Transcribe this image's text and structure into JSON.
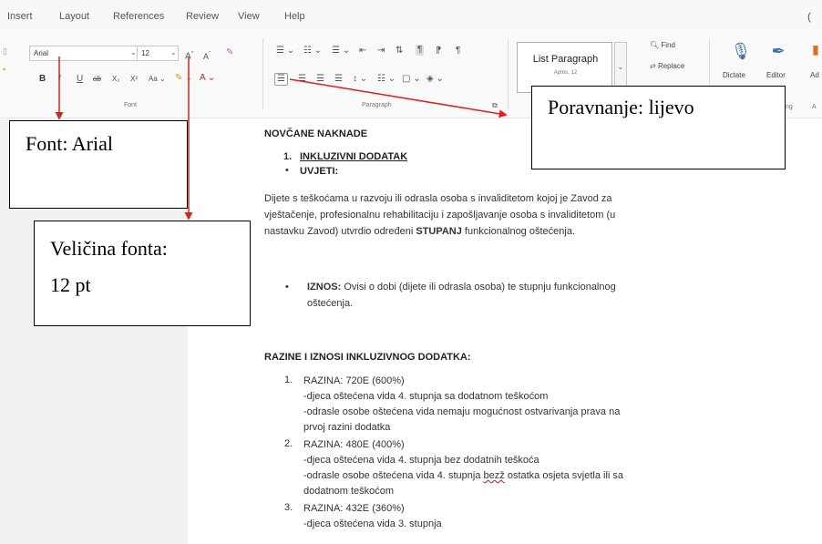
{
  "menu": [
    "Insert",
    "Layout",
    "References",
    "Review",
    "View",
    "Help"
  ],
  "ribbon": {
    "font_name": "Arial",
    "font_size": "12",
    "font_group_label": "Font",
    "paragraph_group_label": "Paragraph",
    "style_name": "List Paragraph",
    "style_sub": "Aptos, 12",
    "find_label": "Find",
    "replace_label": "Replace",
    "dictate_label": "Dictate",
    "editor_label": "Editor",
    "addins_label": "Ad",
    "cut_label": "ng",
    "cut_label2": "A"
  },
  "annotations": {
    "font": "Font: Arial",
    "size_line1": "Veličina fonta:",
    "size_line2": "12 pt",
    "align": "Poravnanje: lijevo"
  },
  "doc": {
    "heading1": "NOVČANE NAKNADE",
    "item1_num": "1.",
    "item1": "INKLUZIVNI DODATAK",
    "bullet_uvjeti": "UVJETI:",
    "para1_l1": "Dijete s teškoćama u razvoju ili odrasla osoba s invaliditetom kojoj je Zavod za",
    "para1_l2": "vještačenje, profesionalnu rehabilitaciju i zapošljavanje osoba s invaliditetom (u",
    "para1_l3a": "nastavku Zavod) utvrdio određeni ",
    "para1_l3b": "STUPANJ",
    "para1_l3c": " funkcionalnog oštećenja.",
    "iznos_bold": "IZNOS:",
    "iznos_l1": " Ovisi o dobi (dijete ili odrasla osoba) te stupnju funkcionalnog",
    "iznos_l2": "oštećenja.",
    "heading2": "RAZINE I IZNOSI INKLUZIVNOG DODATKA:",
    "levels": [
      {
        "num": "1.",
        "title": "RAZINA: 720E (600%)"
      },
      {
        "num": "2.",
        "title": "RAZINA: 480E (400%)"
      },
      {
        "num": "3.",
        "title": "RAZINA: 432E (360%)"
      }
    ],
    "l1_a": "-djeca oštećena vida 4. stupnja sa dodatnom teškoćom",
    "l1_b": "-odrasle osobe oštećena vida nemaju mogućnost ostvarivanja prava na",
    "l1_c": "prvoj razini dodatka",
    "l2_a": "-djeca oštećena vida 4. stupnja bez dodatnih teškoća",
    "l2_b1": "-odrasle osobe oštećena vida 4. stupnja ",
    "l2_b2": "bezž",
    "l2_b3": " ostatka osjeta svjetla ili sa",
    "l2_c": "dodatnom teškoćom",
    "l3_a": "-djeca oštećena vida 3. stupnja"
  },
  "colors": {
    "arrow": "#e0201a",
    "icon_blue": "#3a6fb0",
    "text_red": "#c62828"
  }
}
